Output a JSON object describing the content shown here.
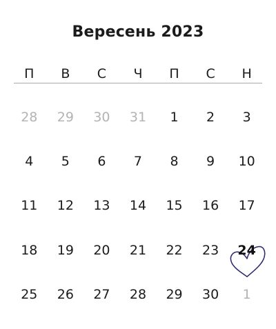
{
  "calendar": {
    "title": "Вересень 2023",
    "weekdays": [
      "П",
      "В",
      "С",
      "Ч",
      "П",
      "С",
      "Н"
    ],
    "days": [
      {
        "label": "28",
        "muted": true
      },
      {
        "label": "29",
        "muted": true
      },
      {
        "label": "30",
        "muted": true
      },
      {
        "label": "31",
        "muted": true
      },
      {
        "label": "1"
      },
      {
        "label": "2"
      },
      {
        "label": "3"
      },
      {
        "label": "4"
      },
      {
        "label": "5"
      },
      {
        "label": "6"
      },
      {
        "label": "7"
      },
      {
        "label": "8"
      },
      {
        "label": "9"
      },
      {
        "label": "10"
      },
      {
        "label": "11"
      },
      {
        "label": "12"
      },
      {
        "label": "13"
      },
      {
        "label": "14"
      },
      {
        "label": "15"
      },
      {
        "label": "16"
      },
      {
        "label": "17"
      },
      {
        "label": "18"
      },
      {
        "label": "19"
      },
      {
        "label": "20"
      },
      {
        "label": "21"
      },
      {
        "label": "22"
      },
      {
        "label": "23"
      },
      {
        "label": "24",
        "highlight": true
      },
      {
        "label": "25"
      },
      {
        "label": "26"
      },
      {
        "label": "27"
      },
      {
        "label": "28"
      },
      {
        "label": "29"
      },
      {
        "label": "30"
      },
      {
        "label": "1",
        "muted": true
      }
    ],
    "highlight_icon": "heart-icon",
    "colors": {
      "text": "#1b1b1b",
      "muted": "#b3b3b3",
      "heart_stroke": "#2a2670",
      "divider": "#a9a9a9"
    }
  }
}
